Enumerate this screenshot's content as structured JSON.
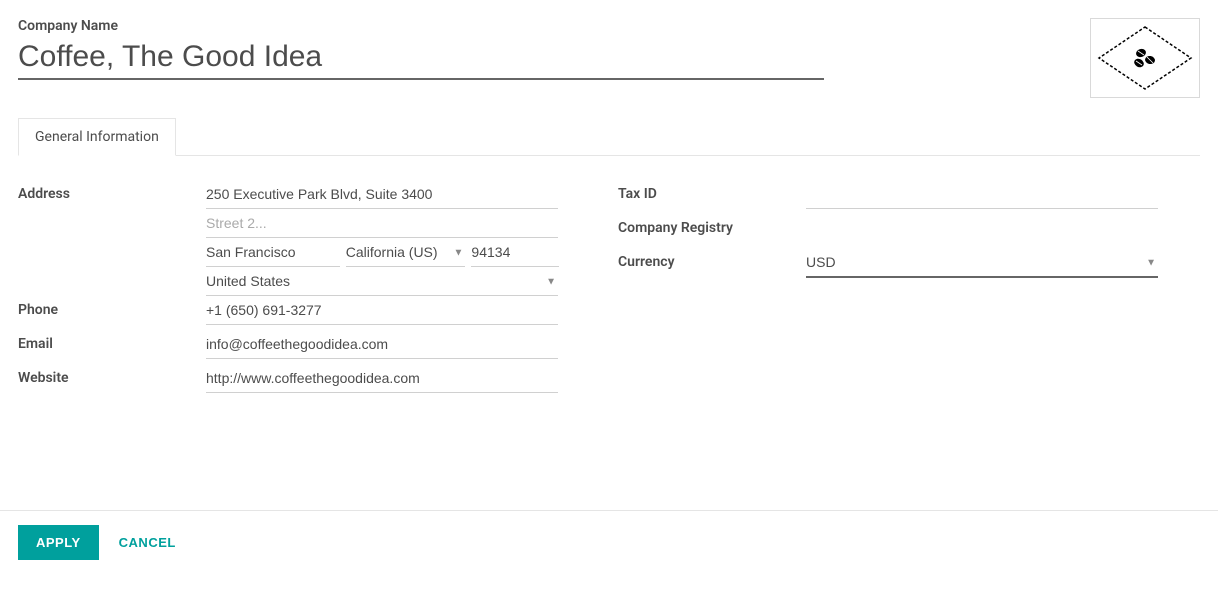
{
  "labels": {
    "company_name": "Company Name",
    "address": "Address",
    "phone": "Phone",
    "email": "Email",
    "website": "Website",
    "tax_id": "Tax ID",
    "company_registry": "Company Registry",
    "currency": "Currency"
  },
  "tabs": {
    "general_information": "General Information"
  },
  "company": {
    "name": "Coffee, The Good Idea",
    "street": "250 Executive Park Blvd, Suite 3400",
    "street2_placeholder": "Street 2...",
    "street2": "",
    "city": "San Francisco",
    "state": "California (US)",
    "zip": "94134",
    "country": "United States",
    "phone": "+1 (650) 691-3277",
    "email": "info@coffeethegoodidea.com",
    "website": "http://www.coffeethegoodidea.com",
    "tax_id": "",
    "company_registry": "",
    "currency": "USD"
  },
  "footer": {
    "apply": "Apply",
    "cancel": "Cancel"
  },
  "logo_alt": "coffee-beans-diamond-logo"
}
